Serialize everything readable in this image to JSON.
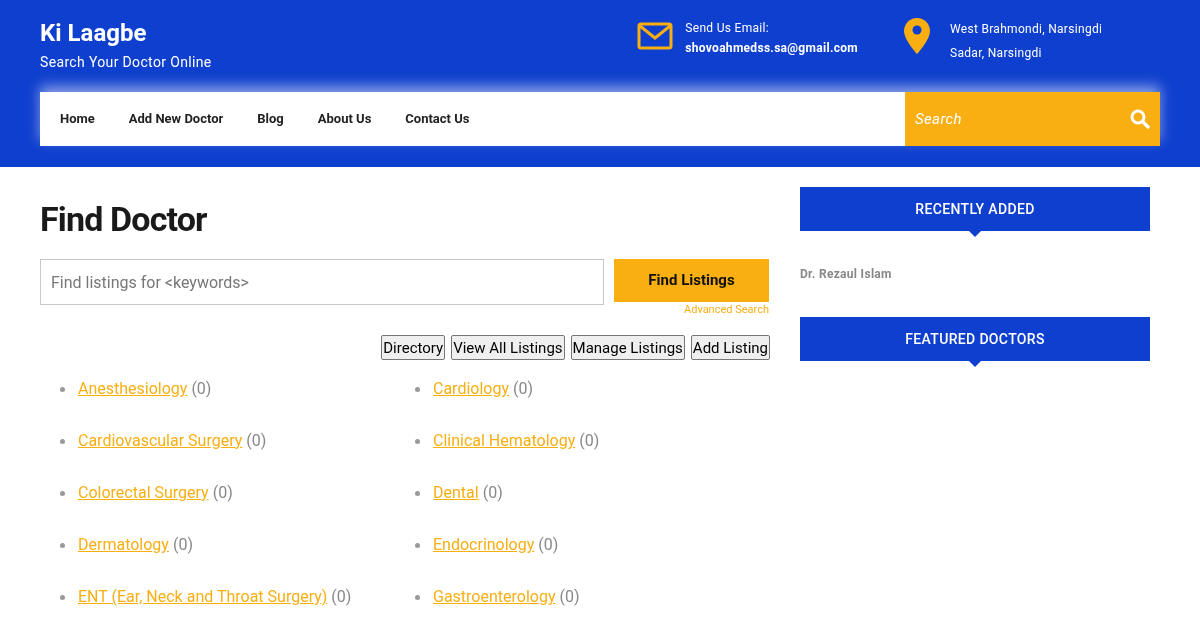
{
  "site": {
    "title": "Ki Laagbe",
    "tagline": "Search Your Doctor Online"
  },
  "contact": {
    "email_label": "Send Us Email:",
    "email": "shovoahmedss.sa@gmail.com",
    "address_line_1": "West Brahmondi, Narsingdi",
    "address_line_2": "Sadar, Narsingdi"
  },
  "nav": {
    "items": [
      "Home",
      "Add New Doctor",
      "Blog",
      "About Us",
      "Contact Us"
    ],
    "search_placeholder": "Search"
  },
  "main": {
    "heading": "Find Doctor",
    "search_placeholder": "Find listings for <keywords>",
    "find_button": "Find Listings",
    "advanced_search": "Advanced Search",
    "actions": [
      "Directory",
      "View All Listings",
      "Manage Listings",
      "Add Listing"
    ],
    "categories": [
      {
        "name": "Anesthesiology",
        "count": "(0)"
      },
      {
        "name": "Cardiology",
        "count": "(0)"
      },
      {
        "name": "Cardiovascular Surgery",
        "count": "(0)"
      },
      {
        "name": "Clinical Hematology",
        "count": "(0)"
      },
      {
        "name": "Colorectal Surgery",
        "count": "(0)"
      },
      {
        "name": "Dental",
        "count": "(0)"
      },
      {
        "name": "Dermatology",
        "count": "(0)"
      },
      {
        "name": "Endocrinology",
        "count": "(0)"
      },
      {
        "name": "ENT (Ear, Neck and Throat Surgery)",
        "count": "(0)"
      },
      {
        "name": "Gastroenterology",
        "count": "(0)"
      }
    ]
  },
  "sidebar": {
    "widgets": [
      {
        "title": "RECENTLY ADDED",
        "items": [
          "Dr. Rezaul Islam"
        ]
      },
      {
        "title": "FEATURED DOCTORS"
      }
    ]
  }
}
